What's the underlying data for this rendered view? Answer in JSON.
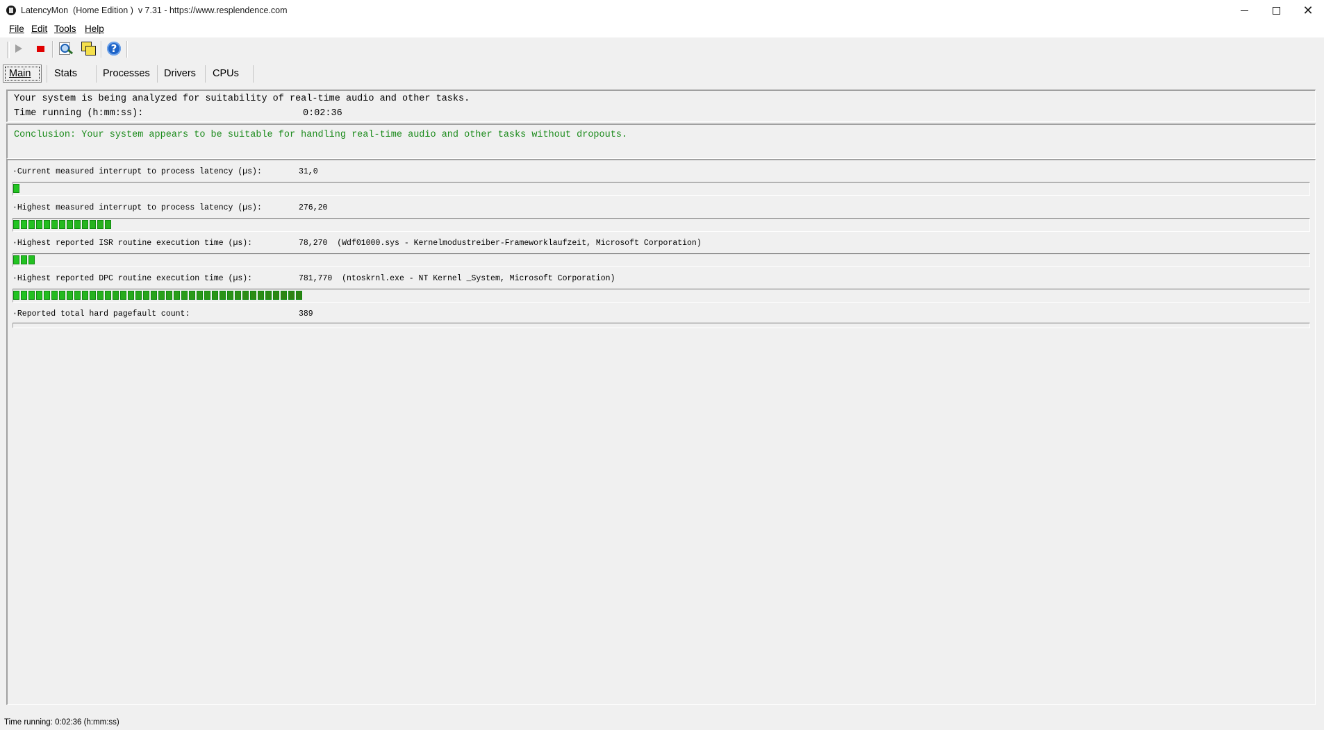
{
  "window": {
    "title": "LatencyMon  (Home Edition )  v 7.31 - https://www.resplendence.com"
  },
  "menu": [
    {
      "label": "File"
    },
    {
      "label": "Edit"
    },
    {
      "label": "Tools"
    },
    {
      "label": "Help"
    }
  ],
  "toolbar": {
    "icons": [
      "play-icon",
      "stop-icon",
      "analyze-icon",
      "windows-icon",
      "help-icon"
    ],
    "help_glyph": "?"
  },
  "tabs": [
    {
      "label": "Main",
      "active": true
    },
    {
      "label": "Stats",
      "active": false
    },
    {
      "label": "Processes",
      "active": false
    },
    {
      "label": "Drivers",
      "active": false
    },
    {
      "label": "CPUs",
      "active": false
    }
  ],
  "status": {
    "analysis_text": "Your system is being analyzed for suitability of real-time audio and other tasks.",
    "time_label": "Time running (h:mm:ss):",
    "time_value": "0:02:36"
  },
  "conclusion": {
    "text": "Conclusion: Your system appears to be suitable for handling real-time audio and other tasks without dropouts.",
    "color": "#1a8a1a"
  },
  "metrics": [
    {
      "label": "·Current measured interrupt to process latency (µs):",
      "value": "31,0",
      "detail": "",
      "bar_level": 0.006
    },
    {
      "label": "·Highest measured interrupt to process latency (µs):",
      "value": "276,20",
      "detail": "",
      "bar_level": 0.076
    },
    {
      "label": "·Highest reported ISR routine execution time (µs):",
      "value": "78,270",
      "detail": "(Wdf01000.sys - Kernelmodustreiber-Frameworklaufzeit, Microsoft Corporation)",
      "bar_level": 0.019
    },
    {
      "label": "·Highest reported DPC routine execution time (µs):",
      "value": "781,770",
      "detail": "(ntoskrnl.exe - NT Kernel _System, Microsoft Corporation)",
      "bar_level": 0.225
    },
    {
      "label": "·Reported total hard pagefault count:",
      "value": "389",
      "detail": "",
      "bar_level": 0.0
    }
  ],
  "statusbar": {
    "text": "Time running: 0:02:36  (h:mm:ss)"
  },
  "colors": {
    "meter_green": "#22c422",
    "meter_dark_green": "#2f7d12",
    "stop_red": "#e00000",
    "help_blue": "#1e64c8"
  }
}
